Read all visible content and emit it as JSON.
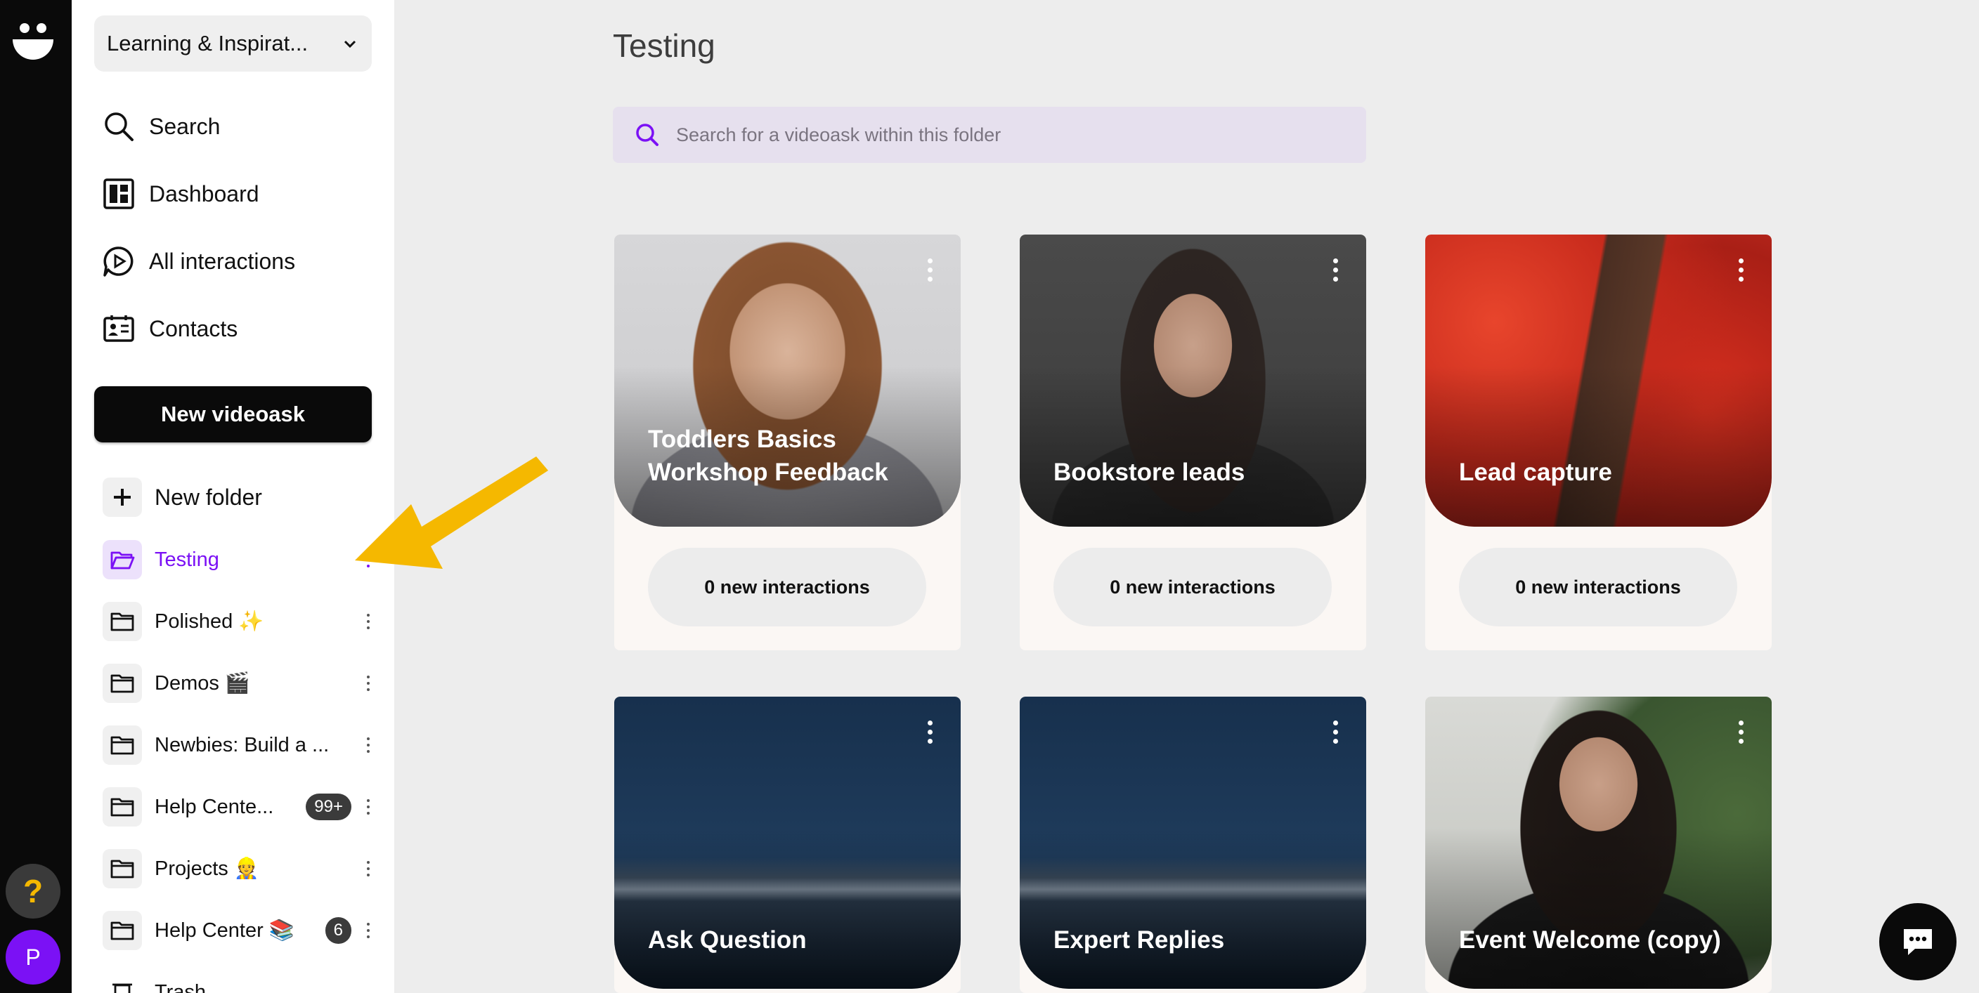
{
  "workspace": {
    "name": "Learning & Inspirat..."
  },
  "nav": [
    {
      "label": "Search",
      "icon": "search-icon"
    },
    {
      "label": "Dashboard",
      "icon": "dashboard-icon"
    },
    {
      "label": "All interactions",
      "icon": "interactions-icon"
    },
    {
      "label": "Contacts",
      "icon": "contacts-icon"
    }
  ],
  "new_videoask_label": "New videoask",
  "new_folder_label": "New folder",
  "folders": [
    {
      "name": "Testing",
      "active": true,
      "badge": ""
    },
    {
      "name": "Polished ✨",
      "badge": ""
    },
    {
      "name": "Demos 🎬",
      "badge": ""
    },
    {
      "name": "Newbies: Build a ...",
      "badge": ""
    },
    {
      "name": "Help Cente...",
      "badge": "99+"
    },
    {
      "name": "Projects 👷",
      "badge": ""
    },
    {
      "name": "Help Center 📚",
      "badge": "6"
    },
    {
      "name": "Trash",
      "badge": ""
    }
  ],
  "rail": {
    "help": "?",
    "avatar": "P"
  },
  "main": {
    "title": "Testing",
    "search_placeholder": "Search for a videoask within this folder"
  },
  "cards": [
    {
      "title": "Toddlers Basics Workshop Feedback",
      "interactions": "0 new interactions"
    },
    {
      "title": "Bookstore leads",
      "interactions": "0 new interactions"
    },
    {
      "title": "Lead capture",
      "interactions": "0 new interactions"
    },
    {
      "title": "Ask Question",
      "interactions": ""
    },
    {
      "title": "Expert Replies",
      "interactions": ""
    },
    {
      "title": "Event Welcome (copy)",
      "interactions": ""
    }
  ],
  "colors": {
    "accent": "#7b11f5",
    "annotation_arrow": "#f5b800",
    "sidebar_bg": "#ffffff",
    "rail_bg": "#0a0a0a"
  }
}
